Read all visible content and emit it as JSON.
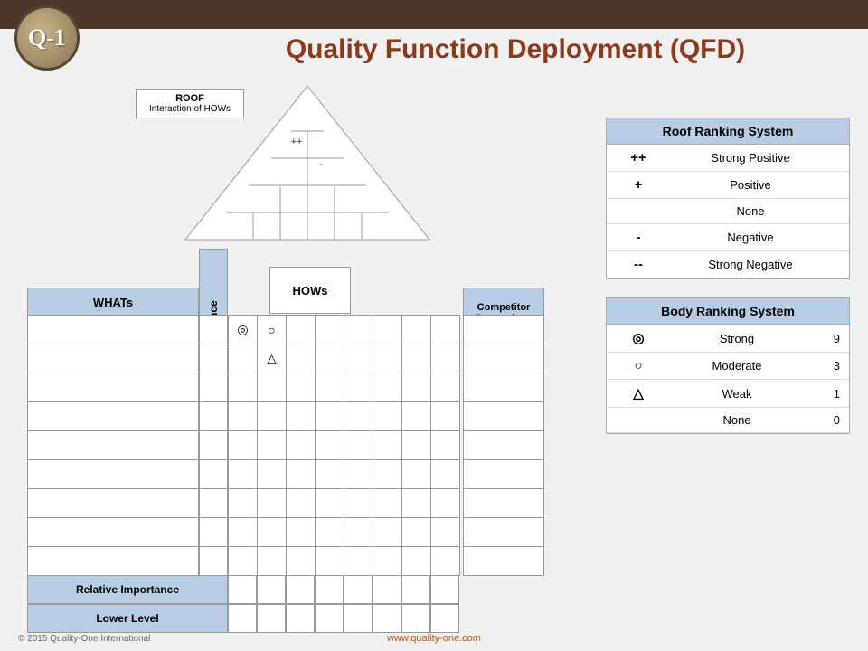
{
  "topBar": {},
  "logo": {
    "text": "Q-1"
  },
  "title": "Quality Function Deployment (QFD)",
  "roofLabel": {
    "title": "ROOF",
    "subtitle": "Interaction of HOWs",
    "symbols": [
      "++",
      "-"
    ]
  },
  "diagram": {
    "whatsLabel": "WHATs",
    "importanceLabel": "Importance",
    "howsLabel": "HOWs",
    "competitorLabel": "Competitor\nComparison",
    "relativeImportanceLabel": "Relative Importance",
    "lowerLevelLabel": "Lower Level",
    "bodySymbols": {
      "row0": [
        "◎",
        "○",
        "",
        "",
        "",
        "",
        "",
        ""
      ],
      "row1": [
        "",
        "△",
        "",
        "",
        "",
        "",
        "",
        ""
      ],
      "row2": [
        "",
        "",
        "",
        "",
        "",
        "",
        "",
        ""
      ],
      "row3": [
        "",
        "",
        "",
        "",
        "",
        "",
        "",
        ""
      ],
      "row4": [
        "",
        "",
        "",
        "",
        "",
        "",
        "",
        ""
      ],
      "row5": [
        "",
        "",
        "",
        "",
        "",
        "",
        "",
        ""
      ],
      "row6": [
        "",
        "",
        "",
        "",
        "",
        "",
        "",
        ""
      ],
      "row7": [
        "",
        "",
        "",
        "",
        "",
        "",
        "",
        ""
      ],
      "row8": [
        "",
        "",
        "",
        "",
        "",
        "",
        "",
        ""
      ]
    },
    "cols": 8,
    "rows": 9
  },
  "roofRanking": {
    "header": "Roof Ranking System",
    "items": [
      {
        "symbol": "++",
        "name": "Strong Positive",
        "value": ""
      },
      {
        "symbol": "+",
        "name": "Positive",
        "value": ""
      },
      {
        "symbol": "",
        "name": "None",
        "value": ""
      },
      {
        "symbol": "-",
        "name": "Negative",
        "value": ""
      },
      {
        "symbol": "--",
        "name": "Strong Negative",
        "value": ""
      }
    ]
  },
  "bodyRanking": {
    "header": "Body Ranking System",
    "items": [
      {
        "symbol": "◎",
        "name": "Strong",
        "value": "9"
      },
      {
        "symbol": "○",
        "name": "Moderate",
        "value": "3"
      },
      {
        "symbol": "△",
        "name": "Weak",
        "value": "1"
      },
      {
        "symbol": "",
        "name": "None",
        "value": "0"
      }
    ]
  },
  "footer": {
    "copyright": "© 2015 Quality-One International",
    "website": "www.quality-one.com"
  }
}
